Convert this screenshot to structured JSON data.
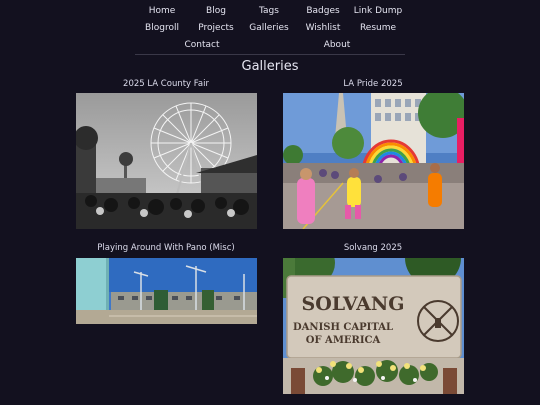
{
  "nav": {
    "row1": [
      "Home",
      "Blog",
      "Tags",
      "Badges",
      "Link Dump"
    ],
    "row2": [
      "Blogroll",
      "Projects",
      "Galleries",
      "Wishlist",
      "Resume"
    ],
    "row3": [
      "Contact",
      "About"
    ]
  },
  "page_title": "Galleries",
  "galleries": [
    {
      "title": "2025 LA County Fair"
    },
    {
      "title": "LA Pride 2025"
    },
    {
      "title": "Playing Around With Pano (Misc)"
    },
    {
      "title": "Solvang 2025"
    }
  ],
  "solvang_sign": {
    "line1": "SOLVANG",
    "line2": "DANISH CAPITAL",
    "line3": "OF AMERICA"
  },
  "colors": {
    "background": "#13111f",
    "text": "#dcdcec",
    "rule": "#3a3848"
  }
}
